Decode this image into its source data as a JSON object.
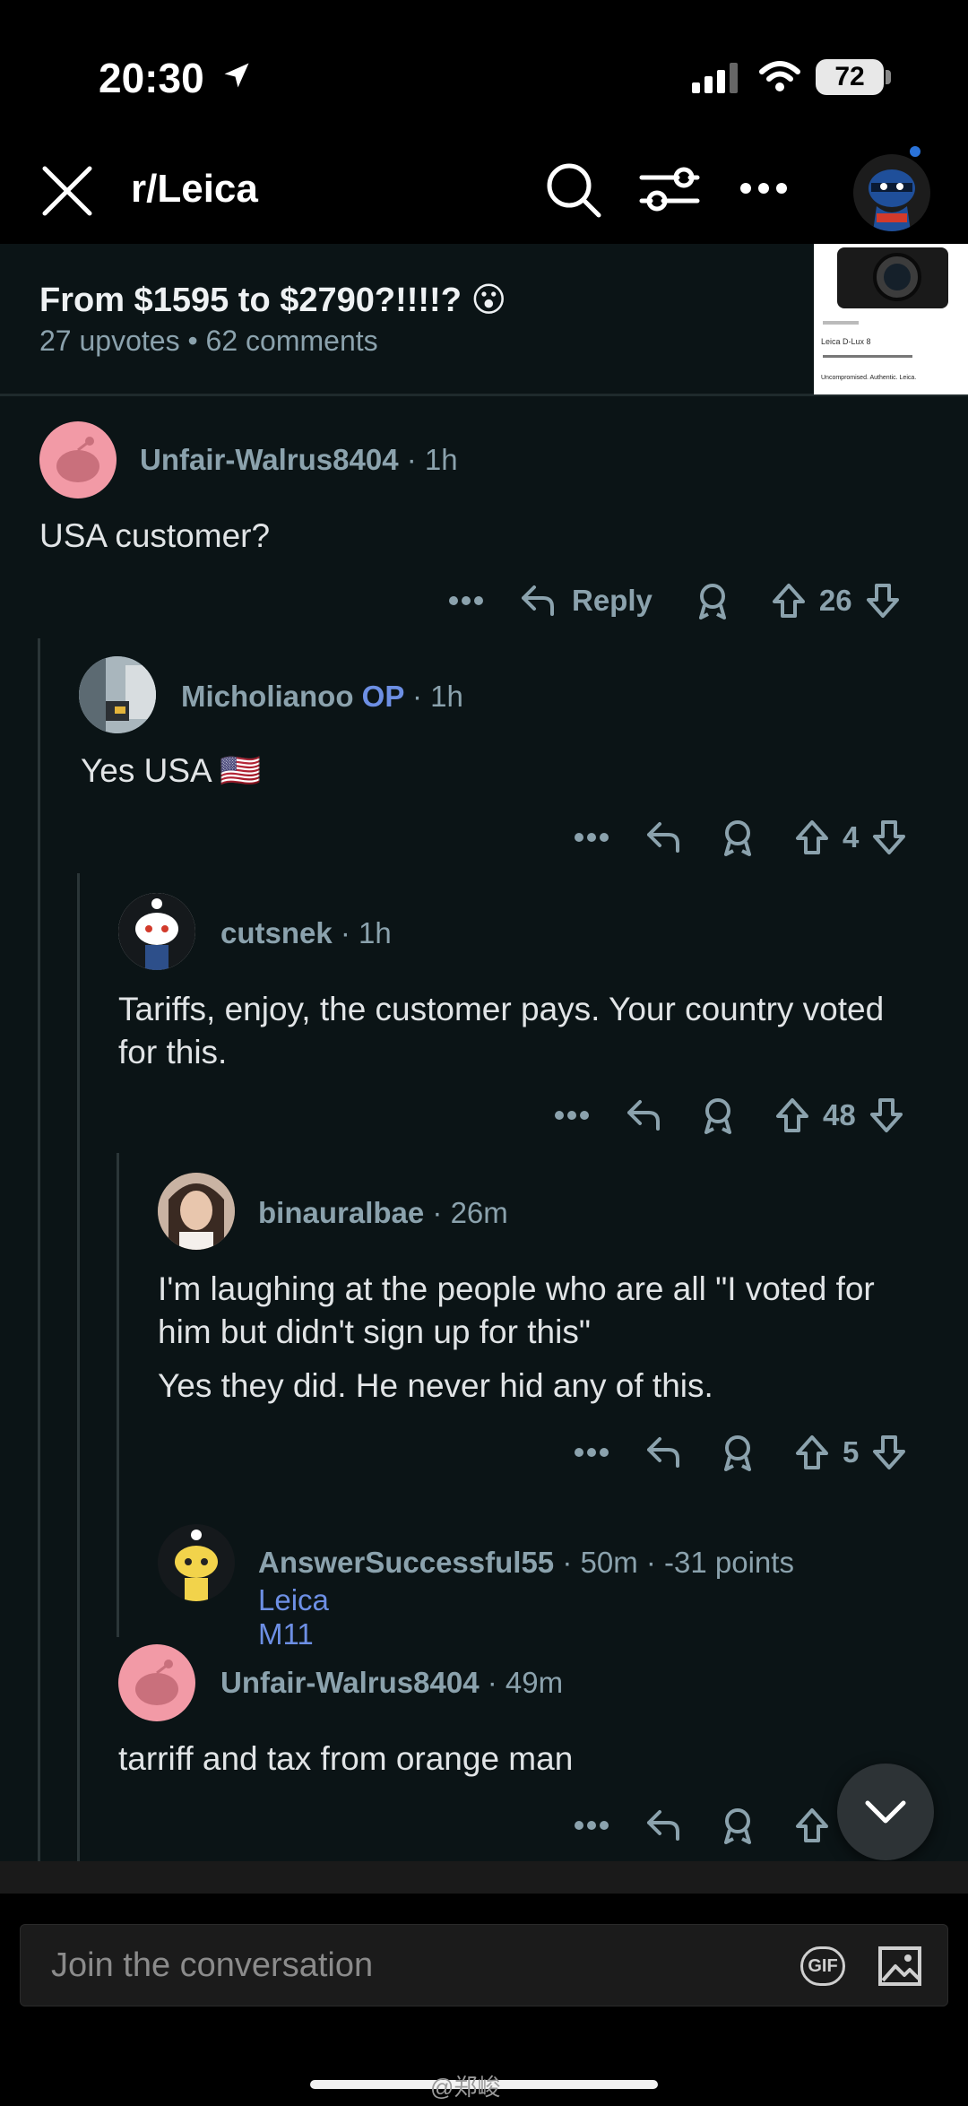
{
  "status_bar": {
    "time": "20:30",
    "battery": "72",
    "icons": [
      "location-arrow-icon",
      "cellular-signal-icon",
      "wifi-icon",
      "battery-icon"
    ]
  },
  "header": {
    "title": "r/Leica",
    "icons": [
      "close-icon",
      "search-icon",
      "sort-filter-icon",
      "more-icon",
      "profile-avatar"
    ]
  },
  "post": {
    "title": "From $1595 to $2790?!!!!? 😮",
    "upvotes": "27 upvotes",
    "separator": "•",
    "comments": "62 comments",
    "thumbnail_caption": "Leica D-Lux 8",
    "thumbnail_tagline": "Uncompromised. Authentic. Leica."
  },
  "comments": [
    {
      "author": "Unfair-Walrus8404",
      "op": "",
      "time": "· 1h",
      "body": "USA customer?",
      "reply_label": "Reply",
      "votes": "26"
    },
    {
      "author": "Micholianoo",
      "op": "OP",
      "time": "· 1h",
      "body": "Yes USA 🇺🇸",
      "votes": "4"
    },
    {
      "author": "cutsnek",
      "op": "",
      "time": "· 1h",
      "body": "Tariffs, enjoy, the customer pays. Your country voted for this.",
      "votes": "48"
    },
    {
      "author": "binauralbae",
      "op": "",
      "time": "· 26m",
      "body": "I'm laughing at the people who are all \"I voted for him but didn't sign up for this\"",
      "body2": "Yes they did. He never hid any of this.",
      "votes": "5"
    },
    {
      "author": "AnswerSuccessful55",
      "time": "· 50m",
      "points": "· -31 points",
      "flair": "Leica M11"
    },
    {
      "author": "Unfair-Walrus8404",
      "op": "",
      "time": "· 49m",
      "body": "tarriff and tax from orange man"
    }
  ],
  "composer": {
    "placeholder": "Join the conversation",
    "gif_label": "GIF"
  },
  "watermark": "@郑峻",
  "colors": {
    "background": "#0b1416",
    "text_meta": "#8ba2ad",
    "op_accent": "#6d8fe4",
    "walrus_avatar": "#f29aa6"
  }
}
